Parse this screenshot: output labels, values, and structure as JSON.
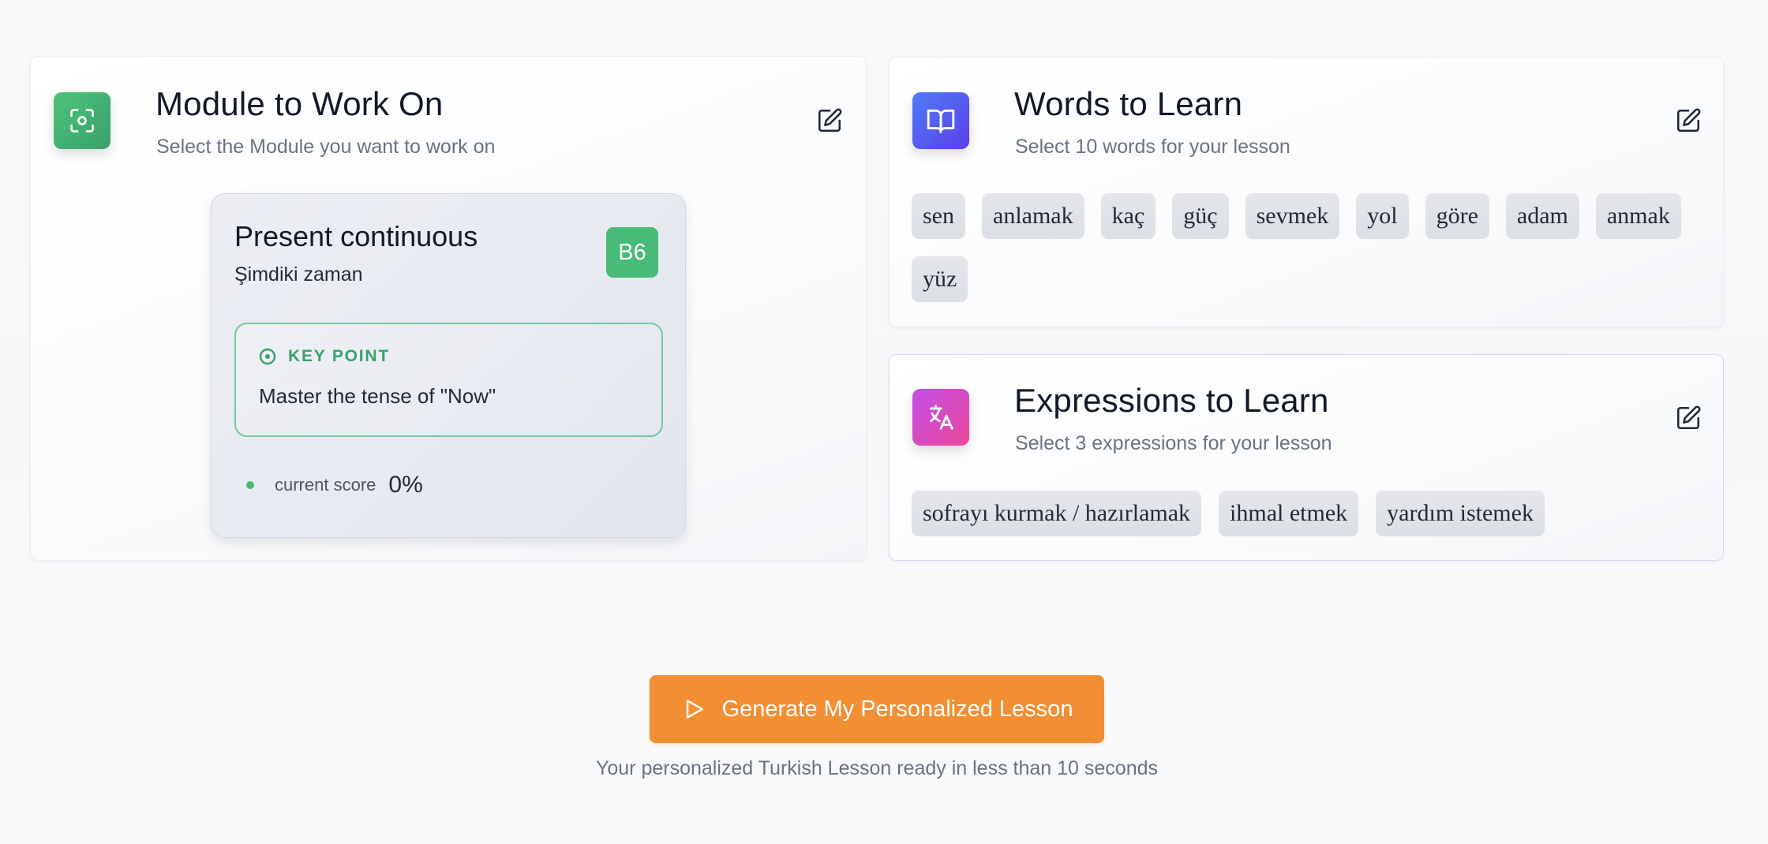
{
  "colors": {
    "module_icon_bg": "#48bb78",
    "words_icon_bg": "#5b5ef0",
    "expr_icon_bg": "#d946ef",
    "badge_bg": "#48bb78",
    "keypoint_accent": "#38a169",
    "cta_bg": "#f28f33"
  },
  "module_card": {
    "icon": "focus-target-icon",
    "title": "Module to Work On",
    "subtitle": "Select the Module you want to work on",
    "edit_icon": "edit-icon",
    "module": {
      "title": "Present continuous",
      "subtitle": "Şimdiki zaman",
      "level": "B6",
      "key_point_label": "KEY POINT",
      "key_point_text": "Master the tense of \"Now\"",
      "score_label": "current score",
      "score_value": "0%"
    }
  },
  "words_card": {
    "icon": "book-icon",
    "title": "Words to Learn",
    "subtitle": "Select 10 words for your lesson",
    "edit_icon": "edit-icon",
    "words": [
      "sen",
      "anlamak",
      "kaç",
      "güç",
      "sevmek",
      "yol",
      "göre",
      "adam",
      "anmak",
      "yüz"
    ]
  },
  "expressions_card": {
    "icon": "translate-icon",
    "title": "Expressions to Learn",
    "subtitle": "Select 3 expressions for your lesson",
    "edit_icon": "edit-icon",
    "expressions": [
      "sofrayı kurmak / hazırlamak",
      "ihmal etmek",
      "yardım istemek"
    ]
  },
  "cta": {
    "icon": "play-icon",
    "label": "Generate My Personalized Lesson",
    "subtext": "Your personalized Turkish Lesson ready in less than 10 seconds"
  }
}
